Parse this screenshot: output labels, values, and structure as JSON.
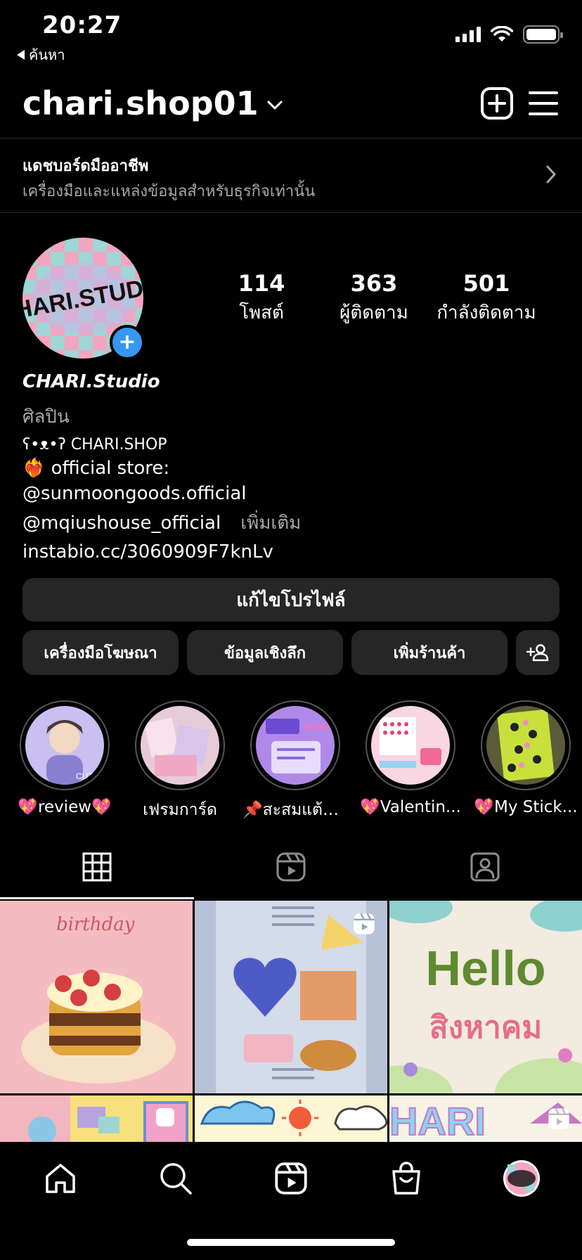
{
  "status_bar": {
    "time": "20:27",
    "back_label": "ค้นหา"
  },
  "header": {
    "username": "chari.shop01"
  },
  "dashboard": {
    "title": "แดชบอร์ดมืออาชีพ",
    "subtitle": "เครื่องมือและแหล่งข้อมูลสำหรับธุรกิจเท่านั้น"
  },
  "stats": [
    {
      "value": "114",
      "label": "โพสต์"
    },
    {
      "value": "363",
      "label": "ผู้ติดตาม"
    },
    {
      "value": "501",
      "label": "กำลังติดตาม"
    }
  ],
  "bio": {
    "name": "CHARI.Studio",
    "category": "ศิลปิน",
    "line1": "ʕ•ᴥ•ʔ CHARI.SHOP",
    "line2": "❤️‍🔥 official store:",
    "line3": "@sunmoongoods.official",
    "line4": "@mqiushouse_official",
    "more": "เพิ่มเติม",
    "link": "instabio.cc/3060909F7knLv"
  },
  "buttons": {
    "edit_profile": "แก้ไขโปรไฟล์",
    "ad_tools": "เครื่องมือโฆษณา",
    "insights": "ข้อมูลเชิงลึก",
    "add_shop": "เพิ่มร้านค้า"
  },
  "highlights": [
    {
      "label": "💖review💖"
    },
    {
      "label": "เฟรมการ์ด"
    },
    {
      "label": "📌สะสมแต้ม..."
    },
    {
      "label": "💖Valentin..."
    },
    {
      "label": "💖My Stick..."
    }
  ],
  "avatar_text": "CHARI.STUDIO",
  "grid_posts": [
    {
      "text": "birthday"
    },
    {
      "text": ""
    },
    {
      "text": "Hello",
      "subtext": "สิงหาคม"
    },
    {
      "text": ""
    },
    {
      "text": ""
    },
    {
      "text": "HARI"
    }
  ],
  "colors": {
    "accent": "#3797f0",
    "button_bg": "#262626",
    "secondary_text": "#a8a8a8"
  }
}
